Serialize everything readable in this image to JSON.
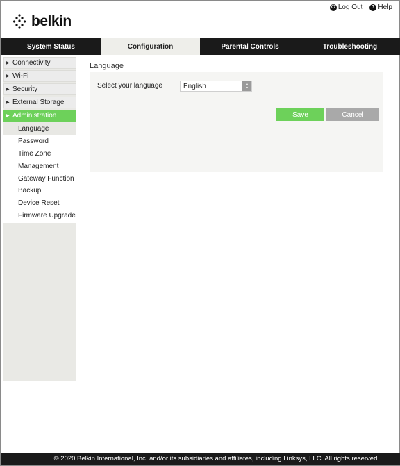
{
  "header": {
    "logo_text": "belkin",
    "logout_label": "Log Out",
    "help_label": "Help",
    "logout_icon": "power-icon",
    "help_icon": "question-icon"
  },
  "nav": {
    "tabs": [
      {
        "label": "System Status",
        "active": false
      },
      {
        "label": "Configuration",
        "active": true
      },
      {
        "label": "Parental Controls",
        "active": false
      },
      {
        "label": "Troubleshooting",
        "active": false
      }
    ]
  },
  "sidebar": {
    "items": [
      {
        "label": "Connectivity"
      },
      {
        "label": "Wi-Fi"
      },
      {
        "label": "Security"
      },
      {
        "label": "External Storage"
      },
      {
        "label": "Administration"
      }
    ],
    "subitems": [
      {
        "label": "Language"
      },
      {
        "label": "Password"
      },
      {
        "label": "Time Zone"
      },
      {
        "label": "Management"
      },
      {
        "label": "Gateway Function"
      },
      {
        "label": "Backup"
      },
      {
        "label": "Device Reset"
      },
      {
        "label": "Firmware Upgrade"
      }
    ]
  },
  "main": {
    "title": "Language",
    "language_label": "Select your language",
    "language_value": "English",
    "save_label": "Save",
    "cancel_label": "Cancel"
  },
  "footer": {
    "text": "© 2020 Belkin International, Inc. and/or its subsidiaries and affiliates, including Linksys, LLC. All rights reserved."
  },
  "colors": {
    "accent_green": "#6dd15a",
    "nav_dark": "#1a1a1a",
    "cancel_gray": "#a9a9a9"
  }
}
